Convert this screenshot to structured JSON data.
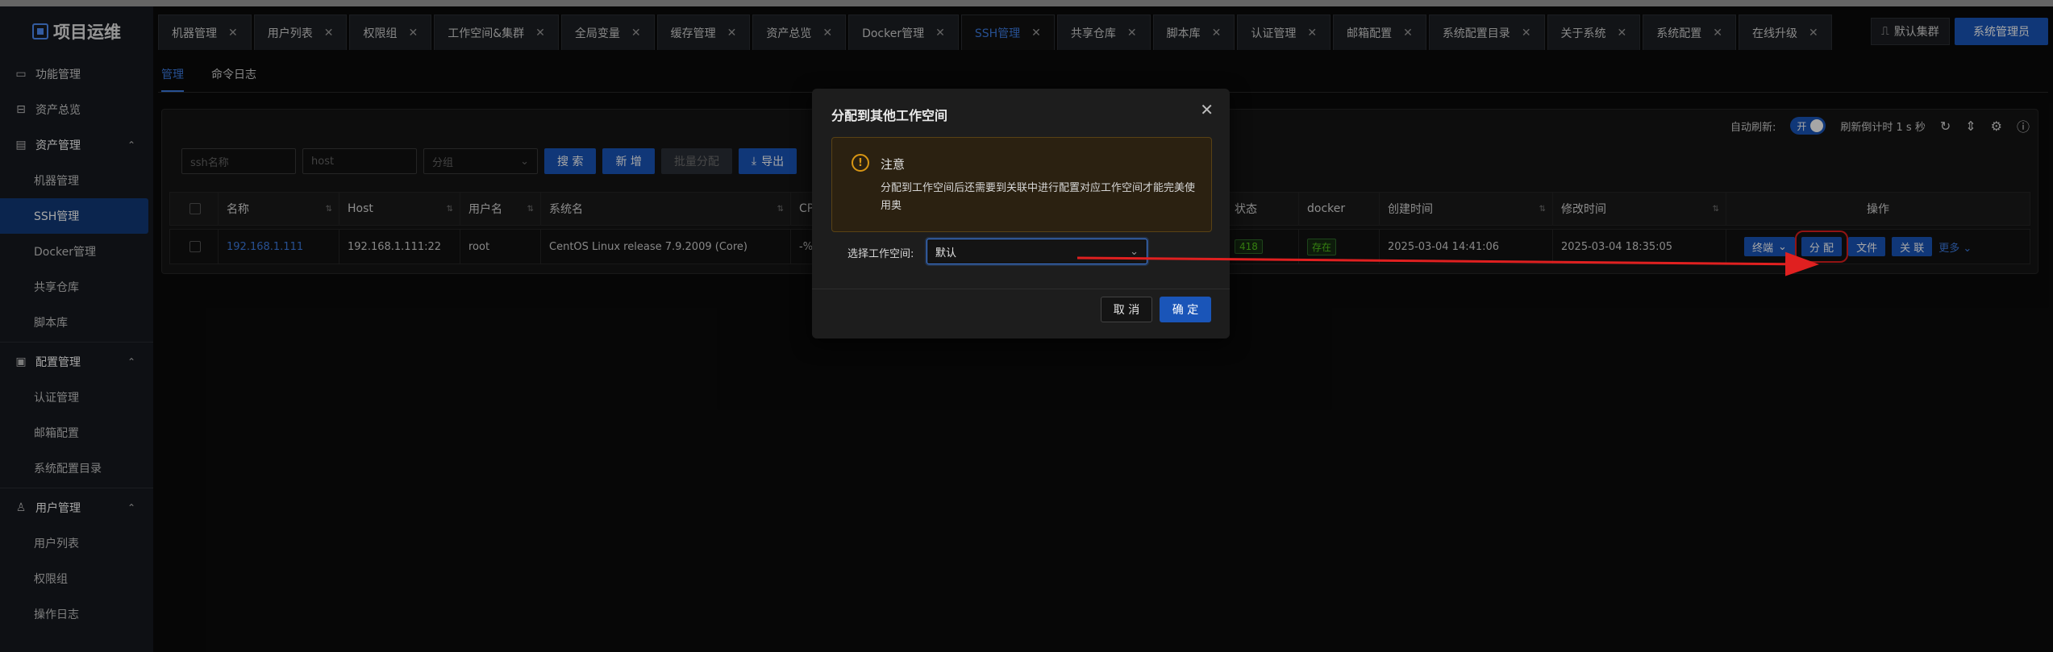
{
  "sidebar": {
    "logo": "项目运维",
    "groups": [
      {
        "label": "功能管理",
        "icon": "monitor-icon"
      },
      {
        "label": "资产总览",
        "icon": "laptop-icon"
      },
      {
        "label": "资产管理",
        "icon": "database-icon",
        "items": [
          "机器管理",
          "SSH管理",
          "Docker管理",
          "共享仓库",
          "脚本库"
        ]
      },
      {
        "label": "配置管理",
        "icon": "profile-icon",
        "items": [
          "认证管理",
          "邮箱配置",
          "系统配置目录"
        ]
      },
      {
        "label": "用户管理",
        "icon": "user-icon",
        "items": [
          "用户列表",
          "权限组",
          "操作日志"
        ]
      }
    ]
  },
  "tabs": [
    {
      "label": "机器管理"
    },
    {
      "label": "用户列表"
    },
    {
      "label": "权限组"
    },
    {
      "label": "工作空间&集群"
    },
    {
      "label": "全局变量"
    },
    {
      "label": "缓存管理"
    },
    {
      "label": "资产总览"
    },
    {
      "label": "Docker管理"
    },
    {
      "label": "SSH管理"
    },
    {
      "label": "共享仓库"
    },
    {
      "label": "脚本库"
    },
    {
      "label": "认证管理"
    },
    {
      "label": "邮箱配置"
    },
    {
      "label": "系统配置目录"
    },
    {
      "label": "关于系统"
    },
    {
      "label": "系统配置"
    },
    {
      "label": "在线升级"
    }
  ],
  "header": {
    "cluster": "默认集群",
    "admin": "系统管理员"
  },
  "subtabs": [
    "管理",
    "命令日志"
  ],
  "toolbar": {
    "auto_refresh_label": "自动刷新:",
    "toggle": "开",
    "countdown": "刷新倒计时 1 s 秒"
  },
  "filters": {
    "ssh_placeholder": "ssh名称",
    "host_placeholder": "host",
    "group_placeholder": "分组",
    "search": "搜 索",
    "add": "新 增",
    "batch": "批量分配",
    "export": "导出"
  },
  "table": {
    "headers": {
      "name": "名称",
      "host": "Host",
      "user": "用户名",
      "os": "系统名",
      "cpu": "CP",
      "status": "状态",
      "docker": "docker",
      "created": "创建时间",
      "modified": "修改时间",
      "ops": "操作"
    },
    "row": {
      "name": "192.168.1.111",
      "host": "192.168.1.111:22",
      "user": "root",
      "os": "CentOS Linux release 7.9.2009 (Core)",
      "cpu": "-%",
      "status": "418",
      "docker": "存在",
      "created": "2025-03-04 14:41:06",
      "modified": "2025-03-04 18:35:05",
      "ops": {
        "terminal": "终端",
        "assign": "分 配",
        "file": "文件",
        "link": "关 联",
        "more": "更多"
      }
    }
  },
  "modal": {
    "title": "分配到其他工作空间",
    "alert_title": "注意",
    "alert_body": "分配到工作空间后还需要到关联中进行配置对应工作空间才能完美使用奥",
    "label": "选择工作空间:",
    "value": "默认",
    "cancel": "取 消",
    "ok": "确 定"
  },
  "colors": {
    "accent": "#1a55b8",
    "link": "#3d7be0",
    "annotation": "#e02020",
    "warning": "#d89614"
  }
}
